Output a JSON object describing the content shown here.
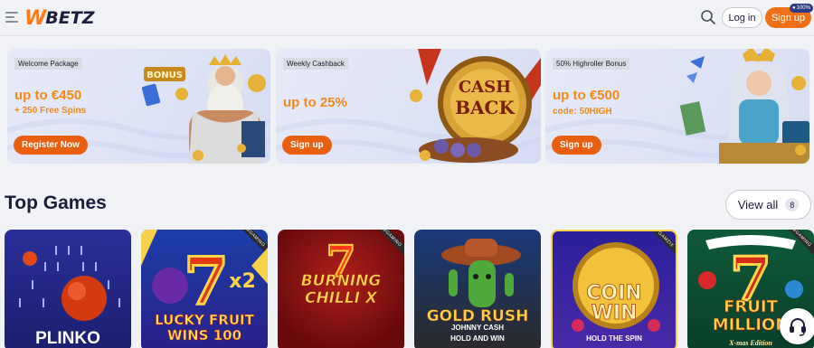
{
  "header": {
    "logo_w": "W",
    "logo_betz": "BETZ",
    "login_label": "Log in",
    "signup_label": "Sign up",
    "signup_badge": "100%"
  },
  "promos": [
    {
      "badge": "Welcome Package",
      "title": "up to €450",
      "subtitle": "+ 250 Free Spins",
      "button": "Register Now",
      "art_text": "BONUS"
    },
    {
      "badge": "Weekly Cashback",
      "title": "up to 25%",
      "subtitle": "",
      "button": "Sign up",
      "art_text": "CASH BACK"
    },
    {
      "badge": "50% Highroller Bonus",
      "title": "up to €500",
      "subtitle": "code: 50HIGH",
      "button": "Sign up",
      "art_text": ""
    }
  ],
  "top_games": {
    "title": "Top Games",
    "view_all_label": "View all",
    "view_all_count": "8",
    "games": [
      {
        "title": "PLINKO",
        "provider_tag": ""
      },
      {
        "title": "LUCKY FRUIT WINS 100",
        "provider_tag": "BGAMING"
      },
      {
        "title": "BURNING CHILLI X",
        "provider_tag": "BGAMING"
      },
      {
        "title": "GOLD RUSH",
        "subtitle": "JOHNNY CASH",
        "tagline": "HOLD AND WIN",
        "provider_tag": "BGAMING"
      },
      {
        "title": "COIN WIN",
        "tagline": "HOLD THE SPIN",
        "provider_tag": "GAMZIX"
      },
      {
        "title": "FRUIT MILLION",
        "tagline": "X-mas Edition",
        "provider_tag": "BGAMING"
      }
    ]
  },
  "colors": {
    "accent": "#f07018",
    "promo_text": "#f28a1a",
    "navy": "#1c1d3a"
  }
}
